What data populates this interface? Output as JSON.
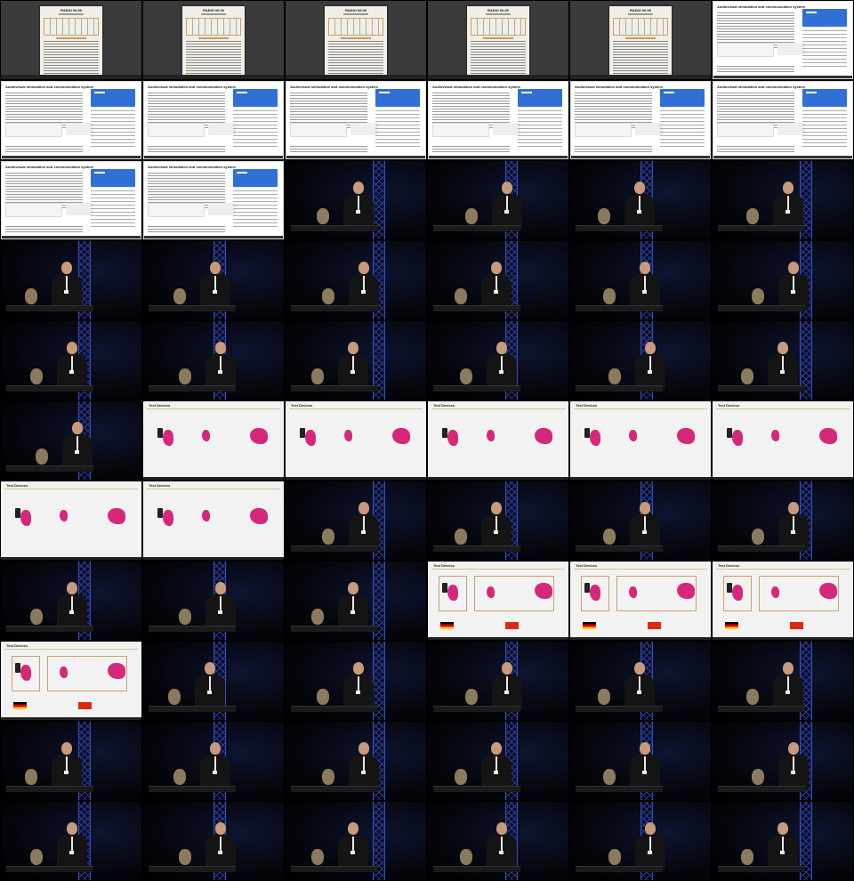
{
  "contact_sheet": {
    "columns": 6,
    "rows": 11,
    "doc_title": "RADIO 06.00",
    "web_title": "Audiovisual stimulation and communication system",
    "slide_title": "Test Devices",
    "thumbnails": [
      {
        "kind": "document"
      },
      {
        "kind": "document"
      },
      {
        "kind": "document"
      },
      {
        "kind": "document"
      },
      {
        "kind": "document"
      },
      {
        "kind": "webpage"
      },
      {
        "kind": "webpage"
      },
      {
        "kind": "webpage"
      },
      {
        "kind": "webpage"
      },
      {
        "kind": "webpage"
      },
      {
        "kind": "webpage"
      },
      {
        "kind": "webpage"
      },
      {
        "kind": "webpage"
      },
      {
        "kind": "webpage"
      },
      {
        "kind": "speaker"
      },
      {
        "kind": "speaker"
      },
      {
        "kind": "speaker"
      },
      {
        "kind": "speaker"
      },
      {
        "kind": "speaker"
      },
      {
        "kind": "speaker"
      },
      {
        "kind": "speaker"
      },
      {
        "kind": "speaker"
      },
      {
        "kind": "speaker"
      },
      {
        "kind": "speaker"
      },
      {
        "kind": "speaker"
      },
      {
        "kind": "speaker"
      },
      {
        "kind": "speaker"
      },
      {
        "kind": "speaker"
      },
      {
        "kind": "speaker"
      },
      {
        "kind": "speaker"
      },
      {
        "kind": "speaker"
      },
      {
        "kind": "slide"
      },
      {
        "kind": "slide"
      },
      {
        "kind": "slide"
      },
      {
        "kind": "slide"
      },
      {
        "kind": "slide"
      },
      {
        "kind": "slide"
      },
      {
        "kind": "slide"
      },
      {
        "kind": "speaker"
      },
      {
        "kind": "speaker"
      },
      {
        "kind": "speaker"
      },
      {
        "kind": "speaker"
      },
      {
        "kind": "speaker"
      },
      {
        "kind": "speaker"
      },
      {
        "kind": "speaker"
      },
      {
        "kind": "slide-flags"
      },
      {
        "kind": "slide-flags"
      },
      {
        "kind": "slide-flags"
      },
      {
        "kind": "slide-flags"
      },
      {
        "kind": "speaker"
      },
      {
        "kind": "speaker"
      },
      {
        "kind": "speaker"
      },
      {
        "kind": "speaker"
      },
      {
        "kind": "speaker"
      },
      {
        "kind": "speaker"
      },
      {
        "kind": "speaker"
      },
      {
        "kind": "speaker"
      },
      {
        "kind": "speaker"
      },
      {
        "kind": "speaker"
      },
      {
        "kind": "speaker"
      },
      {
        "kind": "speaker"
      },
      {
        "kind": "speaker"
      },
      {
        "kind": "speaker"
      },
      {
        "kind": "speaker"
      },
      {
        "kind": "speaker"
      },
      {
        "kind": "speaker"
      }
    ]
  },
  "colors": {
    "background": "#000000",
    "truss_blue": "#2a3c9e",
    "slide_accent": "#d6287a",
    "web_button_blue": "#2f6fd6"
  }
}
